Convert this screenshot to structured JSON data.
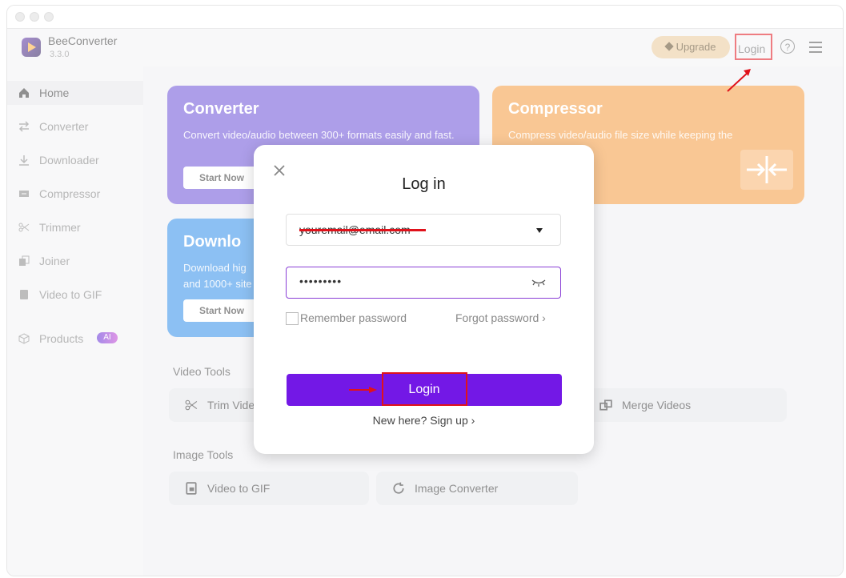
{
  "app": {
    "name": "BeeConverter",
    "version": "3.3.0"
  },
  "header": {
    "upgrade_label": "Upgrade",
    "login_label": "Login",
    "help_icon": "question-circle-icon",
    "menu_icon": "hamburger-icon"
  },
  "sidebar": {
    "items": [
      {
        "label": "Home",
        "icon": "home-icon"
      },
      {
        "label": "Converter",
        "icon": "converter-icon"
      },
      {
        "label": "Downloader",
        "icon": "download-icon"
      },
      {
        "label": "Compressor",
        "icon": "compress-icon"
      },
      {
        "label": "Trimmer",
        "icon": "scissors-icon"
      },
      {
        "label": "Joiner",
        "icon": "joiner-icon"
      },
      {
        "label": "Video to GIF",
        "icon": "gif-icon"
      },
      {
        "label": "Products",
        "icon": "cube-icon",
        "badge": "AI"
      }
    ]
  },
  "cards": {
    "converter": {
      "title": "Converter",
      "desc": "Convert video/audio between 300+ formats easily and fast.",
      "button": "Start Now"
    },
    "compressor": {
      "title": "Compressor",
      "desc": "Compress video/audio file size while keeping the"
    },
    "downloader": {
      "title": "Downlo",
      "desc": "Download hig and 1000+ site",
      "button": "Start Now"
    }
  },
  "video_tools": {
    "title": "Video Tools",
    "trim": "Trim Vide",
    "merge": "Merge Videos"
  },
  "image_tools": {
    "title": "Image Tools",
    "gif": "Video to GIF",
    "image_converter": "Image Converter"
  },
  "modal": {
    "title": "Log in",
    "email_value": "youremail@email.com",
    "password_value": "•••••••••",
    "remember_label": "Remember password",
    "forgot_label": "Forgot password ›",
    "login_button": "Login",
    "signup_label": "New here? Sign up ›"
  },
  "colors": {
    "accent": "#7318e6",
    "highlight": "#e0121b",
    "upgrade": "#e9c99a"
  }
}
